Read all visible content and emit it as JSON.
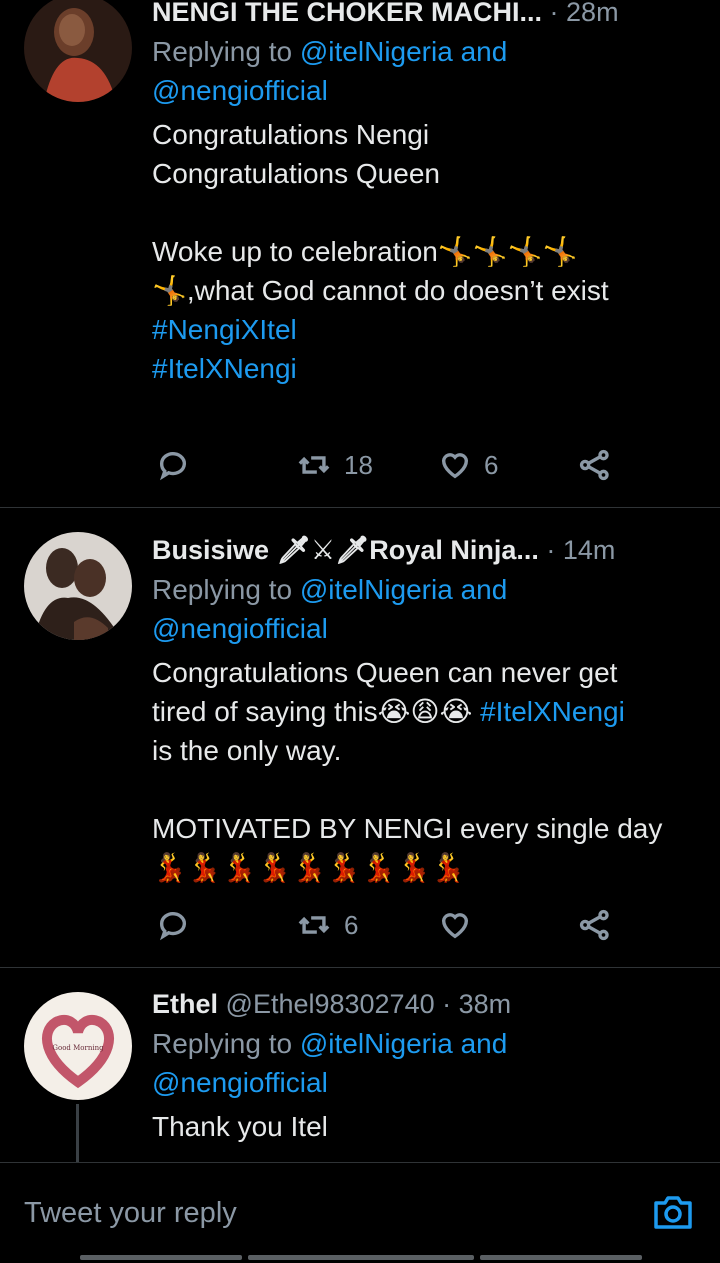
{
  "tweets": [
    {
      "name": "NENGI THE CHOKER MACHI...",
      "handle": "",
      "time": "28m",
      "replying_prefix": "Replying to ",
      "replying_users": "@itelNigeria and",
      "replying_users2": "@nengiofficial",
      "body": "Congratulations Nengi\nCongratulations Queen\n\nWoke up to celebration🤸🤸🤸🤸\n🤸,what God cannot do doesn’t exist\n",
      "hashtags": [
        "#NengiXItel",
        "#ItelXNengi"
      ],
      "retweets": "18",
      "likes": "6"
    },
    {
      "name": "Busisiwe 🗡⚔🗡Royal Ninja...",
      "handle": "",
      "time": "14m",
      "replying_prefix": "Replying to ",
      "replying_users": "@itelNigeria and",
      "replying_users2": "@nengiofficial",
      "body_part1": "Congratulations Queen can never get\ntired of saying this😭😩😭 ",
      "inline_hashtag": "#ItelXNengi",
      "body_part2": "\nis the only way.\n\nMOTIVATED BY NENGI every single day\n💃💃💃💃💃💃💃💃💃",
      "retweets": "6",
      "likes": ""
    },
    {
      "name": "Ethel",
      "handle": "@Ethel98302740",
      "time": "38m",
      "replying_prefix": "Replying to ",
      "replying_users": "@itelNigeria and",
      "replying_users2": "@nengiofficial",
      "body": "Thank you Itel",
      "avatar_text": "Good Morning"
    }
  ],
  "reply_bar": {
    "placeholder": "Tweet your reply"
  },
  "icons": [
    "reply-icon",
    "retweet-icon",
    "like-icon",
    "share-icon",
    "more-icon",
    "camera-icon"
  ],
  "colors": {
    "background": "#000000",
    "link": "#1d9bf0",
    "muted": "#8b98a5",
    "text": "#e7e9ea"
  }
}
